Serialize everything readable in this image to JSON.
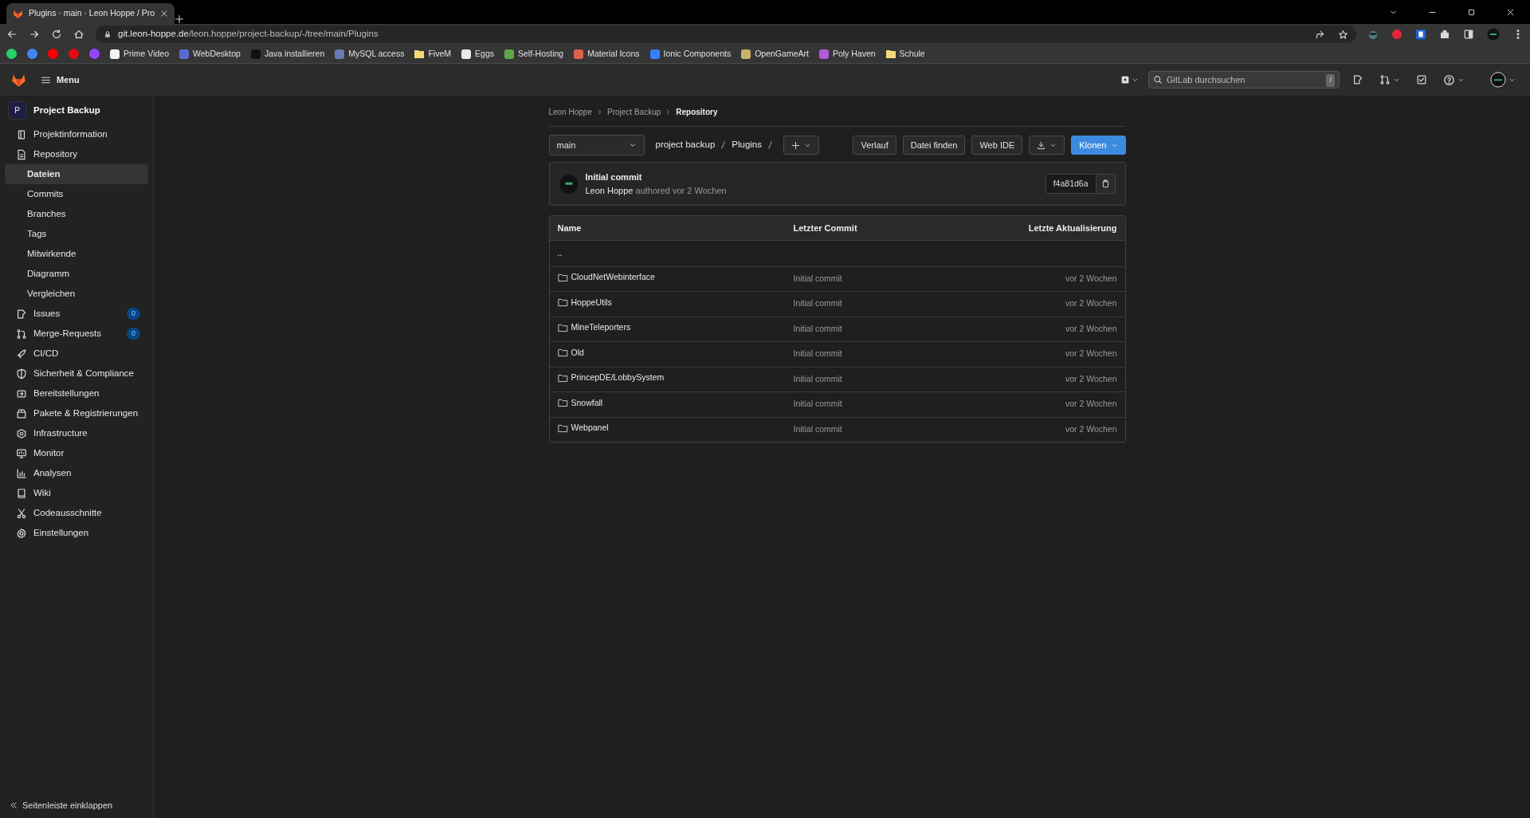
{
  "browser": {
    "tab_title": "Plugins · main · Leon Hoppe / Pro",
    "url": "git.leon-hoppe.de/leon.hoppe/project-backup/-/tree/main/Plugins",
    "bookmarks": [
      {
        "kind": "icon",
        "color": "#25d366"
      },
      {
        "kind": "icon",
        "color": "#4285f4"
      },
      {
        "kind": "icon",
        "color": "#ff0000"
      },
      {
        "kind": "icon",
        "color": "#e50914"
      },
      {
        "kind": "icon",
        "color": "#9146ff"
      },
      {
        "kind": "link",
        "label": "Prime Video",
        "color": "#f2f2f2"
      },
      {
        "kind": "link",
        "label": "WebDesktop",
        "color": "#5b6bd5"
      },
      {
        "kind": "link",
        "label": "Java installieren",
        "color": "#111111"
      },
      {
        "kind": "link",
        "label": "MySQL access",
        "color": "#6a7bb5"
      },
      {
        "kind": "folder",
        "label": "FiveM",
        "color": "#f6d97a"
      },
      {
        "kind": "link",
        "label": "Eggs",
        "color": "#e8e8e8"
      },
      {
        "kind": "link",
        "label": "Self-Hosting",
        "color": "#5fa64a"
      },
      {
        "kind": "link",
        "label": "Material Icons",
        "color": "#e0614a"
      },
      {
        "kind": "link",
        "label": "Ionic Components",
        "color": "#3880ff"
      },
      {
        "kind": "link",
        "label": "OpenGameArt",
        "color": "#c9b36a"
      },
      {
        "kind": "link",
        "label": "Poly Haven",
        "color": "#b05bd8"
      },
      {
        "kind": "folder",
        "label": "Schule",
        "color": "#f6d97a"
      }
    ]
  },
  "header": {
    "menu_label": "Menu",
    "search": {
      "placeholder": "GitLab durchsuchen",
      "shortcut": "/"
    }
  },
  "sidebar": {
    "project": {
      "avatar": "P",
      "name": "Project Backup"
    },
    "items": [
      {
        "label": "Projektinformation",
        "selected": false
      },
      {
        "label": "Repository",
        "selected": false,
        "expanded": true,
        "children": [
          {
            "label": "Dateien",
            "selected": true
          },
          {
            "label": "Commits",
            "selected": false
          },
          {
            "label": "Branches",
            "selected": false
          },
          {
            "label": "Tags",
            "selected": false
          },
          {
            "label": "Mitwirkende",
            "selected": false
          },
          {
            "label": "Diagramm",
            "selected": false
          },
          {
            "label": "Vergleichen",
            "selected": false
          }
        ]
      },
      {
        "label": "Issues",
        "selected": false,
        "badge": "0"
      },
      {
        "label": "Merge-Requests",
        "selected": false,
        "badge": "0"
      },
      {
        "label": "CI/CD",
        "selected": false
      },
      {
        "label": "Sicherheit & Compliance",
        "selected": false
      },
      {
        "label": "Bereitstellungen",
        "selected": false
      },
      {
        "label": "Pakete & Registrierungen",
        "selected": false
      },
      {
        "label": "Infrastructure",
        "selected": false
      },
      {
        "label": "Monitor",
        "selected": false
      },
      {
        "label": "Analysen",
        "selected": false
      },
      {
        "label": "Wiki",
        "selected": false
      },
      {
        "label": "Codeausschnitte",
        "selected": false
      },
      {
        "label": "Einstellungen",
        "selected": false
      }
    ],
    "collapse_label": "Seitenleiste einklappen"
  },
  "breadcrumb": [
    "Leon Hoppe",
    "Project Backup",
    "Repository"
  ],
  "toolbar": {
    "branch": "main",
    "path": [
      "project backup",
      "Plugins"
    ],
    "buttons": [
      "Verlauf",
      "Datei finden",
      "Web IDE"
    ],
    "clone_label": "Klonen"
  },
  "commit": {
    "title": "Initial commit",
    "author": "Leon Hoppe",
    "meta": "authored vor 2 Wochen",
    "sha": "f4a81d6a"
  },
  "table": {
    "columns": [
      "Name",
      "Letzter Commit",
      "Letzte Aktualisierung"
    ],
    "parent_row": "..",
    "rows": [
      {
        "kind": "folder",
        "name": "CloudNetWebinterface",
        "commit": "Initial commit",
        "updated": "vor 2 Wochen"
      },
      {
        "kind": "folder",
        "name": "HoppeUtils",
        "commit": "Initial commit",
        "updated": "vor 2 Wochen"
      },
      {
        "kind": "folder",
        "name": "MineTeleporters",
        "commit": "Initial commit",
        "updated": "vor 2 Wochen"
      },
      {
        "kind": "folder",
        "name": "Old",
        "commit": "Initial commit",
        "updated": "vor 2 Wochen"
      },
      {
        "kind": "folder",
        "name": "PrincepDE/LobbySystem",
        "commit": "Initial commit",
        "updated": "vor 2 Wochen"
      },
      {
        "kind": "folder",
        "name": "Snowfall",
        "commit": "Initial commit",
        "updated": "vor 2 Wochen"
      },
      {
        "kind": "folder",
        "name": "Webpanel",
        "commit": "Initial commit",
        "updated": "vor 2 Wochen"
      }
    ]
  }
}
